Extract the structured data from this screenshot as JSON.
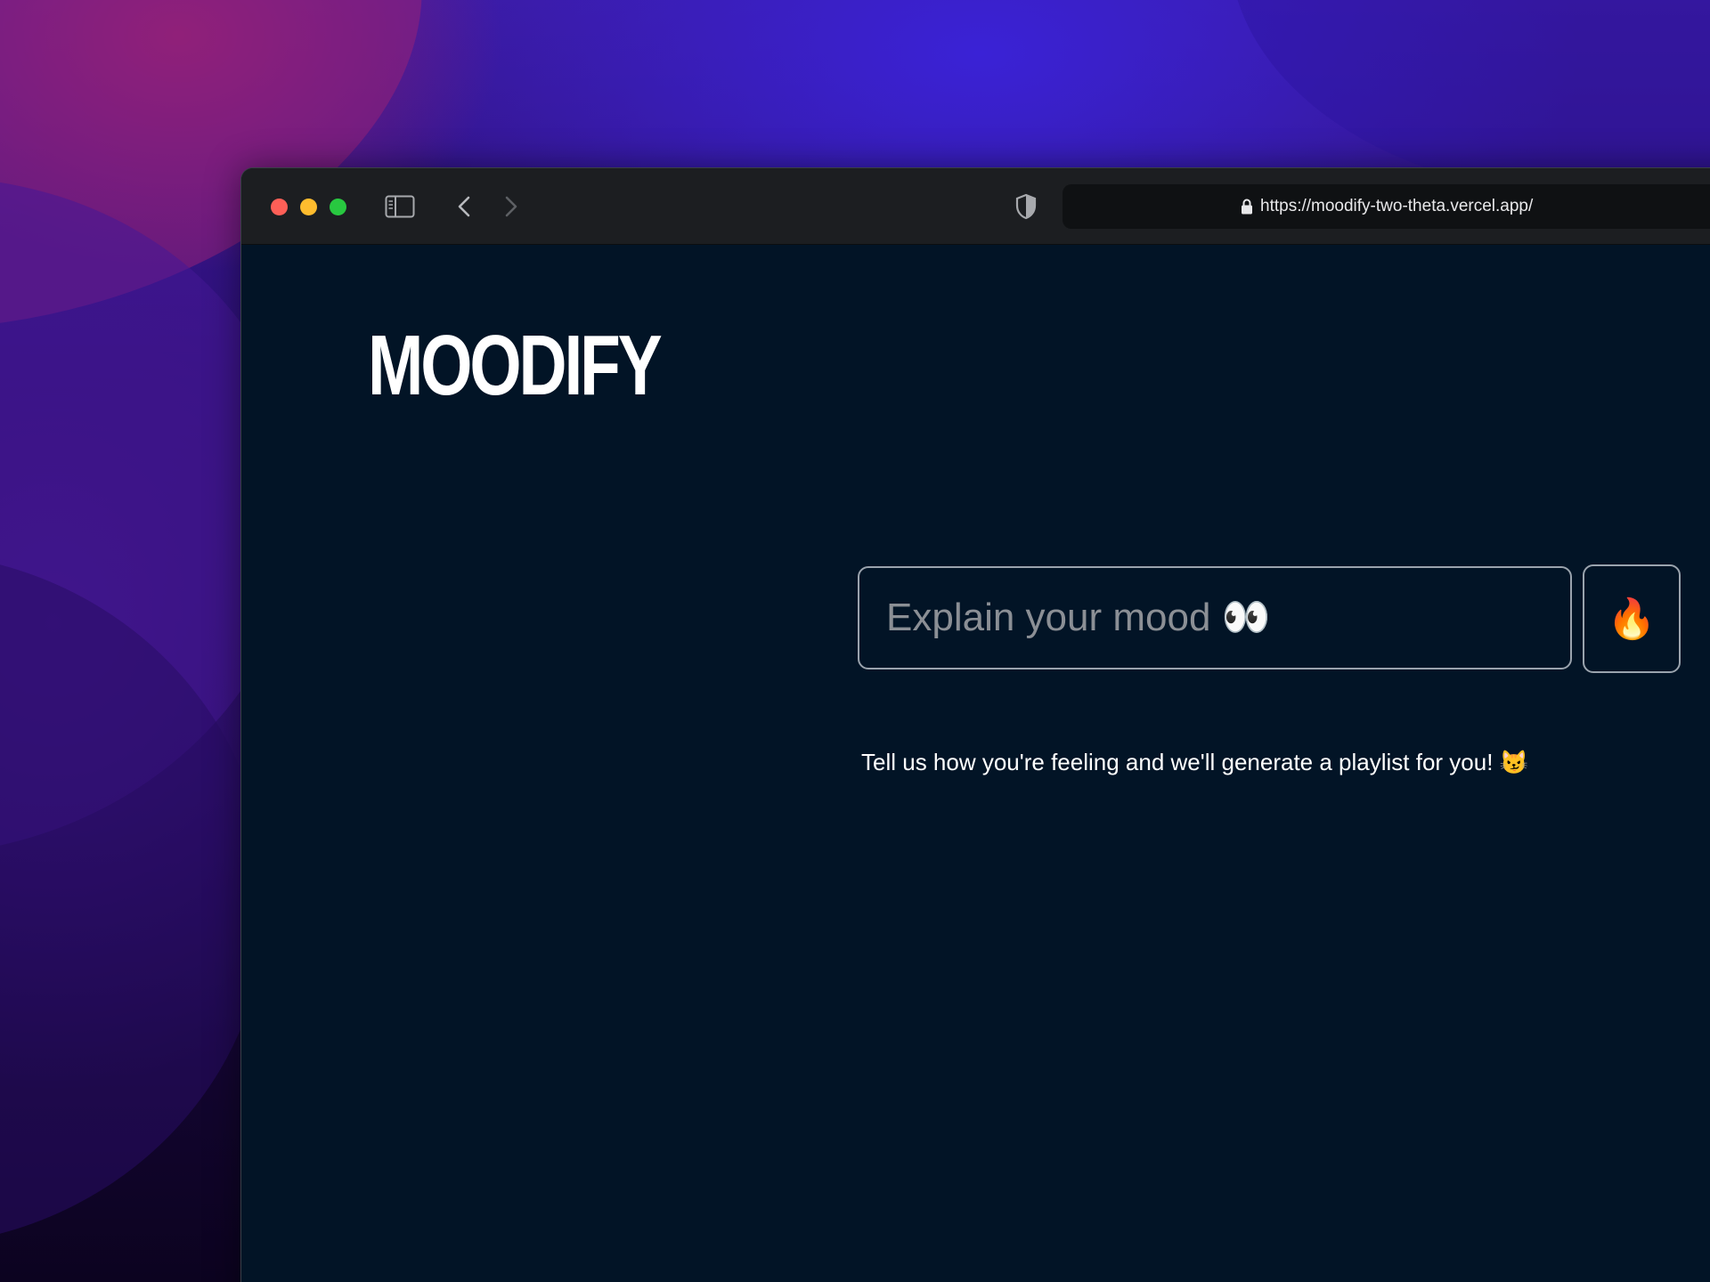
{
  "browser": {
    "url": "https://moodify-two-theta.vercel.app/",
    "toolbar_icons": [
      "sidebar-icon",
      "back-chevron-icon",
      "forward-chevron-icon",
      "shield-icon",
      "lock-icon"
    ]
  },
  "app": {
    "logo": "MOODIFY",
    "mood_input": {
      "value": "",
      "placeholder": "Explain your mood 👀"
    },
    "submit_button": {
      "label": "🔥"
    },
    "tagline": "Tell us how you're feeling and we'll generate a playlist for you! 😼"
  },
  "colors": {
    "page_background": "#021426",
    "toolbar_background": "#1c1e21",
    "input_border": "#9aa3ad",
    "placeholder": "#8b8f95",
    "text": "#ffffff"
  }
}
